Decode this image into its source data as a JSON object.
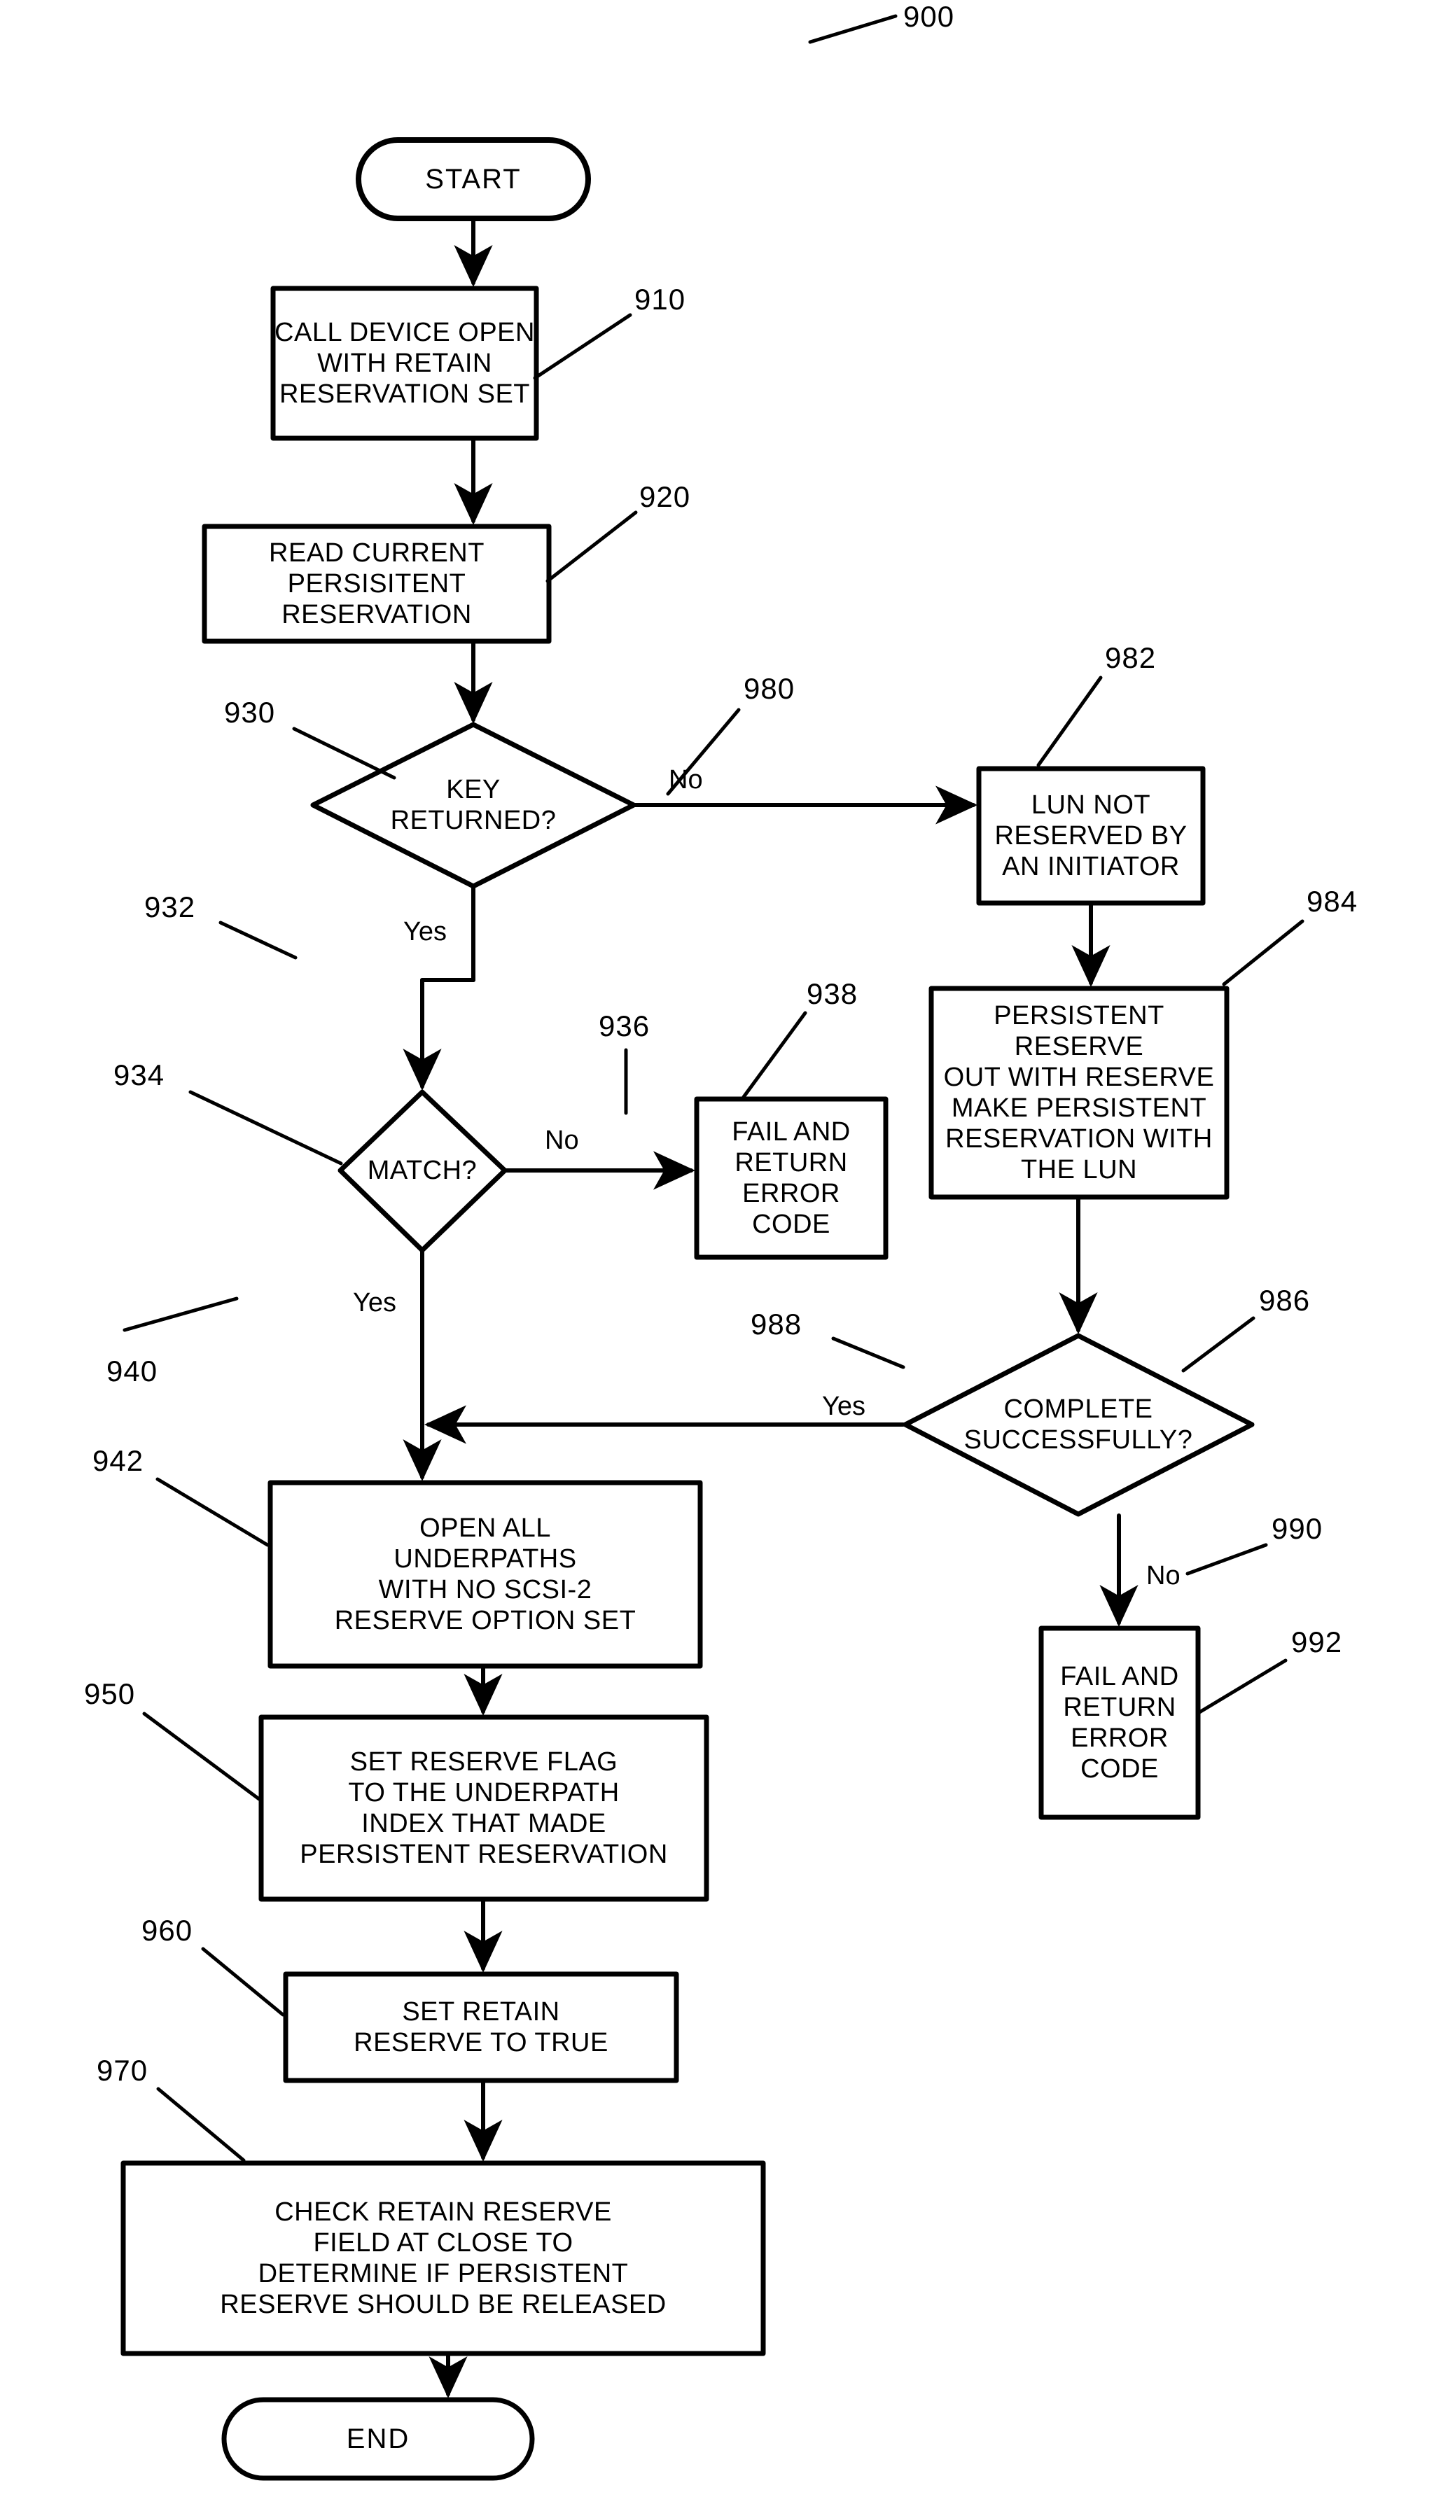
{
  "figure": {
    "number": "900",
    "kind": "patent-flowchart"
  },
  "terminators": {
    "start": "START",
    "end": "END"
  },
  "nodes": {
    "n910": {
      "ref": "910",
      "text": "CALL DEVICE OPEN\nWITH RETAIN\nRESERVATION SET"
    },
    "n920": {
      "ref": "920",
      "text": "READ CURRENT\nPERSISITENT RESERVATION"
    },
    "n930": {
      "ref": "930",
      "text": "KEY\nRETURNED?"
    },
    "n934": {
      "ref": "934",
      "text": "MATCH?"
    },
    "n938": {
      "ref": "938",
      "text": "FAIL AND\nRETURN\nERROR\nCODE"
    },
    "n942": {
      "ref": "942",
      "text": "OPEN ALL\nUNDERPATHS\nWITH NO SCSI-2\nRESERVE OPTION SET"
    },
    "n950": {
      "ref": "950",
      "text": "SET RESERVE FLAG\nTO THE UNDERPATH\nINDEX THAT MADE\nPERSISTENT RESERVATION"
    },
    "n960": {
      "ref": "960",
      "text": "SET RETAIN\nRESERVE TO TRUE"
    },
    "n970": {
      "ref": "970",
      "text": "CHECK RETAIN RESERVE\nFIELD AT CLOSE TO\nDETERMINE IF PERSISTENT\nRESERVE SHOULD BE RELEASED"
    },
    "n982": {
      "ref": "982",
      "text": "LUN NOT\nRESERVED BY\nAN INITIATOR"
    },
    "n984": {
      "ref": "984",
      "text": "PERSISTENT RESERVE\nOUT WITH RESERVE\nMAKE PERSISTENT\nRESERVATION WITH\nTHE LUN"
    },
    "n986": {
      "ref": "986",
      "text": "COMPLETE\nSUCCESSFULLY?"
    },
    "n992": {
      "ref": "992",
      "text": "FAIL AND\nRETURN\nERROR\nCODE"
    }
  },
  "edge_labels": {
    "key_no": "No",
    "key_yes": "Yes",
    "match_no": "No",
    "match_yes": "Yes",
    "complete_yes": "Yes",
    "complete_no": "No"
  },
  "reference_numerals": {
    "r900": "900",
    "r910": "910",
    "r920": "920",
    "r930": "930",
    "r932": "932",
    "r934": "934",
    "r936": "936",
    "r938": "938",
    "r940": "940",
    "r942": "942",
    "r950": "950",
    "r960": "960",
    "r970": "970",
    "r980": "980",
    "r982": "982",
    "r984": "984",
    "r986": "986",
    "r988": "988",
    "r990": "990",
    "r992": "992"
  },
  "colors": {
    "ink": "#000000",
    "paper": "#ffffff"
  }
}
